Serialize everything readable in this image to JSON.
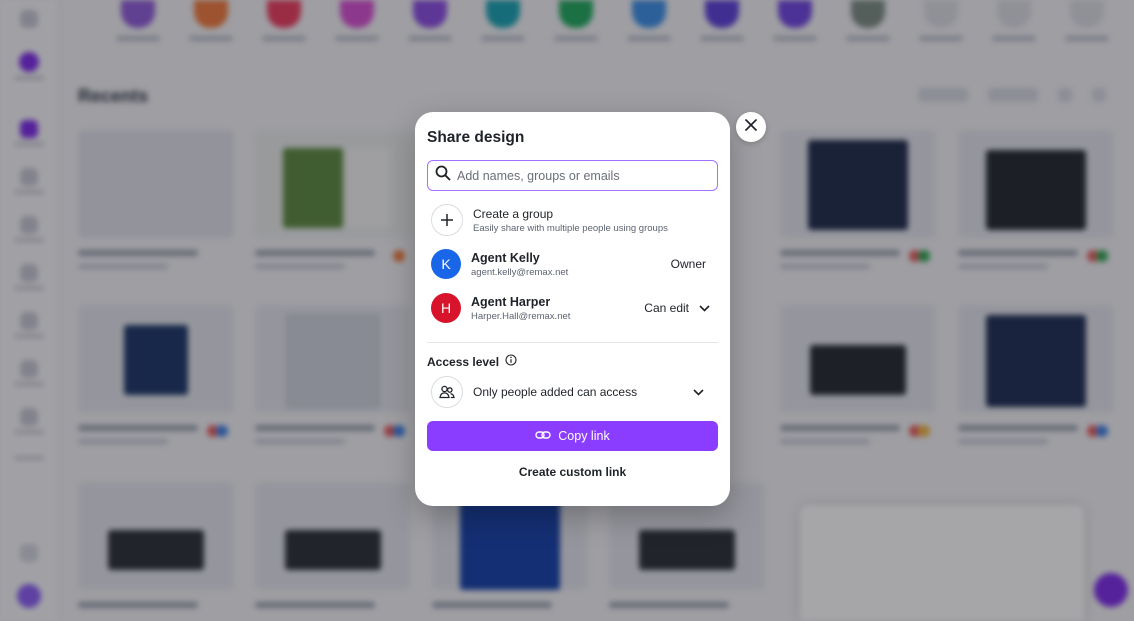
{
  "modal": {
    "title": "Share design",
    "search_placeholder": "Add names, groups or emails",
    "create_group": {
      "title": "Create a group",
      "subtitle": "Easily share with multiple people using groups"
    },
    "people": [
      {
        "initial": "K",
        "name": "Agent Kelly",
        "email": "agent.kelly@remax.net",
        "role": "Owner",
        "color": "#1a66e8"
      },
      {
        "initial": "H",
        "name": "Agent Harper",
        "email": "Harper.Hall@remax.net",
        "role": "Can edit",
        "color": "#d8142c"
      }
    ],
    "access_level_label": "Access level",
    "access_option": "Only people added can access",
    "copy_link_label": "Copy link",
    "custom_link_label": "Create custom link"
  },
  "background": {
    "recents_title": "Recents"
  },
  "colors": {
    "accent": "#8b3dff",
    "focus_border": "#a570ff"
  },
  "icons": {
    "close": "close-icon",
    "search": "search-icon",
    "plus": "plus-icon",
    "info": "info-icon",
    "people": "people-icon",
    "chevron": "chevron-down-icon",
    "link": "link-icon"
  }
}
